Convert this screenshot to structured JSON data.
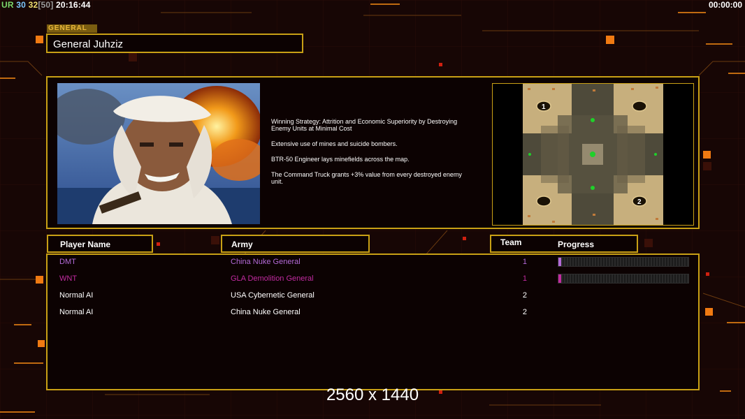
{
  "hud": {
    "stat_a": "UR",
    "stat_b": "30",
    "stat_c": "32",
    "stat_d": "[50]",
    "clock": "20:16:44",
    "game_timer": "00:00:00"
  },
  "general": {
    "tag": "GENERAL",
    "name": "General Juhziz"
  },
  "strategy": {
    "lines": [
      "Winning Strategy: Attrition and Economic Superiority by Destroying\n Enemy Units at Minimal Cost",
      "Extensive use of mines and suicide bombers.",
      "BTR-50 Engineer lays minefields across the map.",
      "The Command Truck grants +3% value from every destroyed enemy\n unit."
    ]
  },
  "minimap": {
    "start_1": "1",
    "start_2": "2"
  },
  "headers": {
    "player_name": "Player Name",
    "army": "Army",
    "team": "Team",
    "progress": "Progress"
  },
  "players": [
    {
      "name": "DMT",
      "army": "China Nuke General",
      "team": "1",
      "color": "#b46ad8",
      "progress": 0.02,
      "show_progress": true
    },
    {
      "name": "WNT",
      "army": "GLA Demolition General",
      "team": "1",
      "color": "#c22ba0",
      "progress": 0.02,
      "show_progress": true
    },
    {
      "name": "Normal AI",
      "army": "USA Cybernetic General",
      "team": "2",
      "color": "#ffffff",
      "progress": 0,
      "show_progress": false
    },
    {
      "name": "Normal AI",
      "army": "China Nuke General",
      "team": "2",
      "color": "#ffffff",
      "progress": 0,
      "show_progress": false
    }
  ],
  "resolution": "2560 x 1440",
  "colors": {
    "frame": "#c8a015",
    "hud_ur": "#7cd86a",
    "hud_30": "#7cc8ff",
    "hud_32": "#f0e070",
    "hud_50": "#9a9a9a"
  }
}
